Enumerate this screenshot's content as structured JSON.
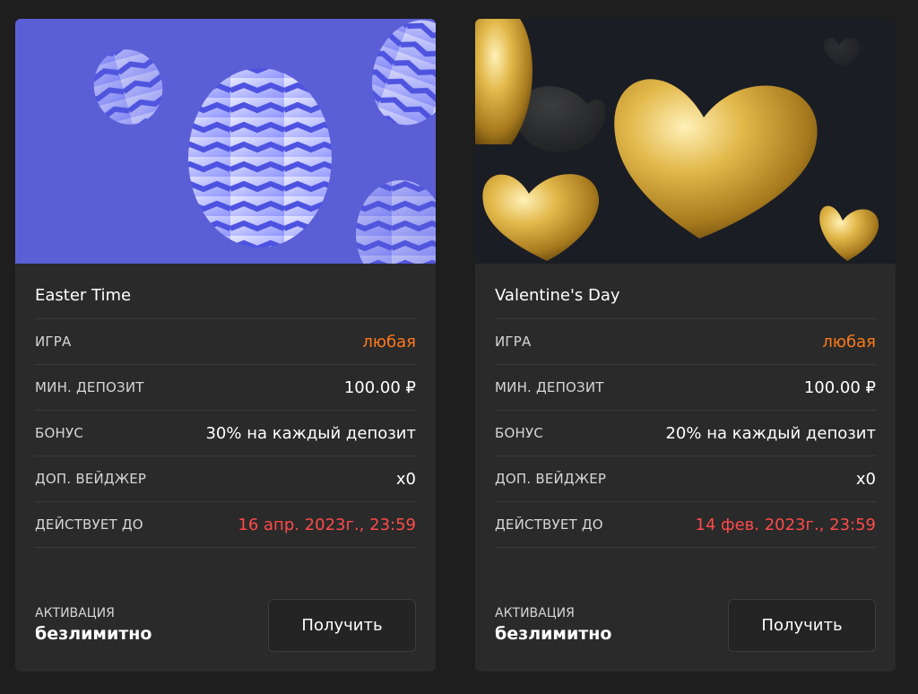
{
  "cards": [
    {
      "title": "Easter Time",
      "banner_theme": "easter-eggs",
      "rows": [
        {
          "label": "ИГРА",
          "value": "любая"
        },
        {
          "label": "МИН. ДЕПОЗИТ",
          "value": "100.00 ₽"
        },
        {
          "label": "БОНУС",
          "value": "30% на каждый депозит"
        },
        {
          "label": "ДОП. ВЕЙДЖЕР",
          "value": "x0"
        },
        {
          "label": "ДЕЙСТВУЕТ ДО",
          "value": "16 апр. 2023г., 23:59"
        }
      ],
      "activation_label": "АКТИВАЦИЯ",
      "activation_value": "безлимитно",
      "button_label": "Получить"
    },
    {
      "title": "Valentine's Day",
      "banner_theme": "golden-hearts",
      "rows": [
        {
          "label": "ИГРА",
          "value": "любая"
        },
        {
          "label": "МИН. ДЕПОЗИТ",
          "value": "100.00 ₽"
        },
        {
          "label": "БОНУС",
          "value": "20% на каждый депозит"
        },
        {
          "label": "ДОП. ВЕЙДЖЕР",
          "value": "x0"
        },
        {
          "label": "ДЕЙСТВУЕТ ДО",
          "value": "14 фев. 2023г., 23:59"
        }
      ],
      "activation_label": "АКТИВАЦИЯ",
      "activation_value": "безлимитно",
      "button_label": "Получить"
    }
  ],
  "colors": {
    "page_bg": "#1e1e1e",
    "card_bg": "#2a2a2a",
    "accent_orange": "#ff7a1a",
    "danger_red": "#ff4a4a",
    "easter_banner_bg": "#5b5fd6",
    "valentine_banner_bg": "#1b1d24"
  }
}
